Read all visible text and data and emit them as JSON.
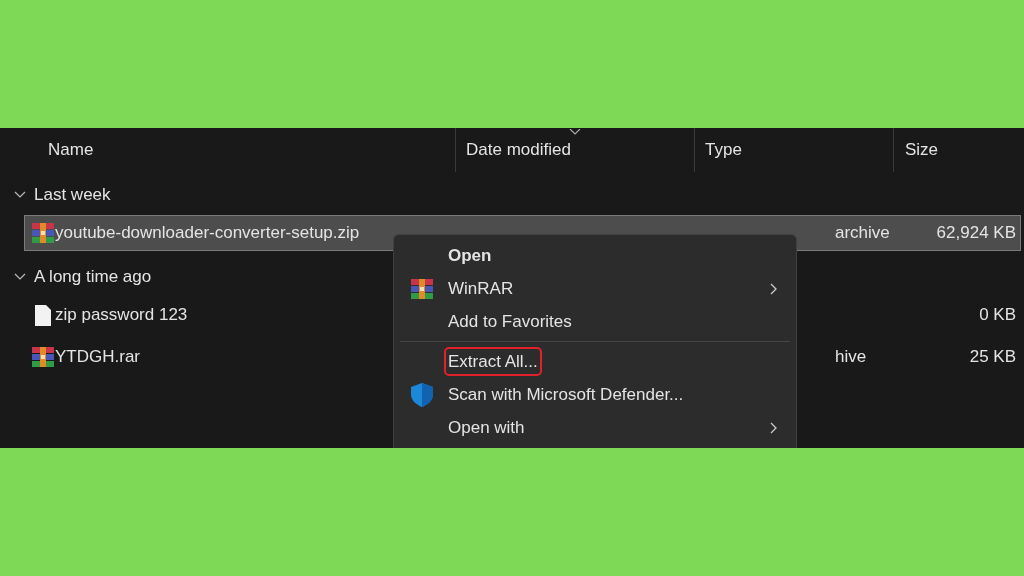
{
  "columns": [
    {
      "label": "Name",
      "sorted": false
    },
    {
      "label": "Date modified",
      "sorted": true
    },
    {
      "label": "Type",
      "sorted": false
    },
    {
      "label": "Size",
      "sorted": false
    }
  ],
  "groups": [
    {
      "label": "Last week",
      "expanded": true,
      "files": [
        {
          "name": "youtube-downloader-converter-setup.zip",
          "kind": "archive",
          "selected": true,
          "type": "archive",
          "size": "62,924 KB"
        }
      ]
    },
    {
      "label": "A long time ago",
      "expanded": true,
      "files": [
        {
          "name": "zip password 123",
          "kind": "text",
          "selected": false,
          "size": "0 KB"
        },
        {
          "name": "YTDGH.rar",
          "kind": "archive",
          "selected": false,
          "type": "hive",
          "size": "25 KB"
        }
      ]
    }
  ],
  "context_menu": {
    "items": [
      {
        "label": "Open",
        "kind": "item",
        "default": true,
        "submenu": false,
        "highlighted": false
      },
      {
        "label": "WinRAR",
        "kind": "archive_item",
        "default": false,
        "submenu": true,
        "highlighted": false
      },
      {
        "label": "Add to Favorites",
        "kind": "item",
        "default": false,
        "submenu": false,
        "highlighted": false
      },
      {
        "kind": "separator"
      },
      {
        "label": "Extract All...",
        "kind": "item",
        "default": false,
        "submenu": false,
        "highlighted": true
      },
      {
        "label": "Scan with Microsoft Defender...",
        "kind": "shield_item",
        "default": false,
        "submenu": false,
        "highlighted": false
      },
      {
        "label": "Open with",
        "kind": "item",
        "default": false,
        "submenu": true,
        "highlighted": false
      }
    ]
  }
}
